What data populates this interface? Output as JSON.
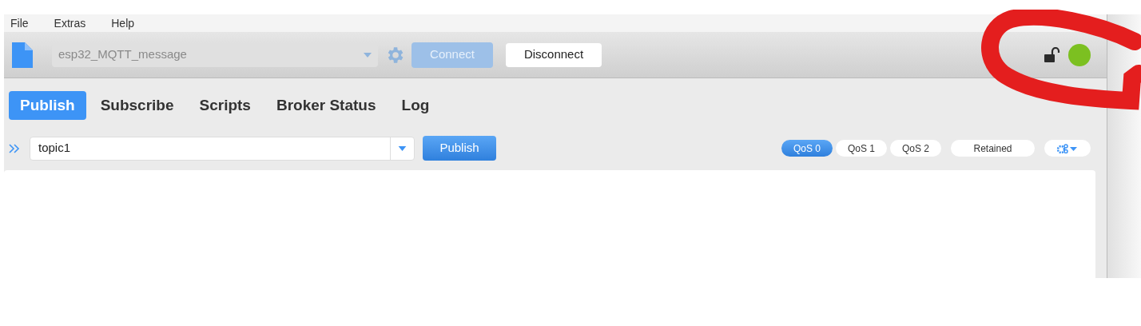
{
  "menu": [
    "File",
    "Extras",
    "Help"
  ],
  "toolbar": {
    "profile": {
      "value": "esp32_MQTT_message",
      "disabled": true
    },
    "connect": {
      "label": "Connect",
      "disabled": true
    },
    "disconnect": {
      "label": "Disconnect",
      "disabled": false
    },
    "locked": false,
    "status_dot": {
      "color": "#7cc021"
    }
  },
  "tabs": [
    {
      "label": "Publish",
      "selected": true
    },
    {
      "label": "Subscribe",
      "selected": false
    },
    {
      "label": "Scripts",
      "selected": false
    },
    {
      "label": "Broker Status",
      "selected": false
    },
    {
      "label": "Log",
      "selected": false
    }
  ],
  "publish": {
    "topic": "topic1",
    "button": "Publish",
    "qos": [
      {
        "label": "QoS 0",
        "selected": true
      },
      {
        "label": "QoS 1",
        "selected": false
      },
      {
        "label": "QoS 2",
        "selected": false
      }
    ],
    "retained": {
      "label": "Retained",
      "selected": false
    }
  }
}
